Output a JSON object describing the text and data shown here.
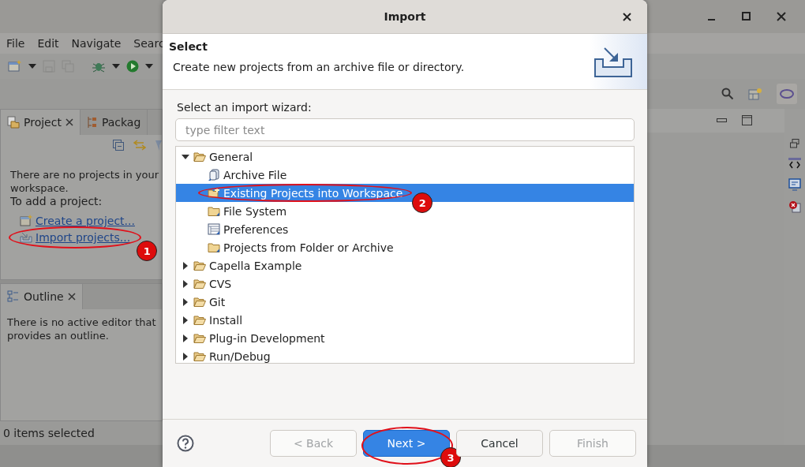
{
  "window": {
    "menu": [
      "File",
      "Edit",
      "Navigate",
      "Searc"
    ]
  },
  "project_explorer": {
    "tabs": [
      {
        "label": "Project",
        "selected": true
      },
      {
        "label": "Packag",
        "selected": false
      }
    ],
    "message": "There are no projects in your workspace.",
    "prompt": "To add a project:",
    "links": [
      {
        "label": "Create a project...",
        "kind": "create"
      },
      {
        "label": "Import projects...",
        "kind": "import",
        "annotation": "1"
      }
    ]
  },
  "outline": {
    "tab": "Outline",
    "message": "There is no active editor that provides an outline."
  },
  "status_bar": "0 items selected",
  "dialog": {
    "title": "Import",
    "heading": "Select",
    "description": "Create new projects from an archive file or directory.",
    "filter_label": "Select an import wizard:",
    "filter": {
      "placeholder": "type filter text"
    },
    "tree": [
      {
        "label": "General",
        "kind": "category",
        "expanded": true,
        "selected": false,
        "children": [
          {
            "label": "Archive File",
            "kind": "archive",
            "selected": false
          },
          {
            "label": "Existing Projects into Workspace",
            "kind": "project",
            "selected": true,
            "annotation": "2"
          },
          {
            "label": "File System",
            "kind": "folder",
            "selected": false
          },
          {
            "label": "Preferences",
            "kind": "preferences",
            "selected": false
          },
          {
            "label": "Projects from Folder or Archive",
            "kind": "folder",
            "selected": false
          }
        ]
      },
      {
        "label": "Capella Example",
        "kind": "category",
        "expanded": false,
        "selected": false
      },
      {
        "label": "CVS",
        "kind": "category",
        "expanded": false,
        "selected": false
      },
      {
        "label": "Git",
        "kind": "category",
        "expanded": false,
        "selected": false
      },
      {
        "label": "Install",
        "kind": "category",
        "expanded": false,
        "selected": false
      },
      {
        "label": "Plug-in Development",
        "kind": "category",
        "expanded": false,
        "selected": false
      },
      {
        "label": "Run/Debug",
        "kind": "category",
        "expanded": false,
        "selected": false
      }
    ],
    "buttons": [
      {
        "label": "< Back",
        "disabled": true,
        "default": false
      },
      {
        "label": "Next >",
        "disabled": false,
        "default": true,
        "annotation": "3"
      },
      {
        "label": "Cancel",
        "disabled": false,
        "default": false
      },
      {
        "label": "Finish",
        "disabled": true,
        "default": false
      }
    ]
  }
}
